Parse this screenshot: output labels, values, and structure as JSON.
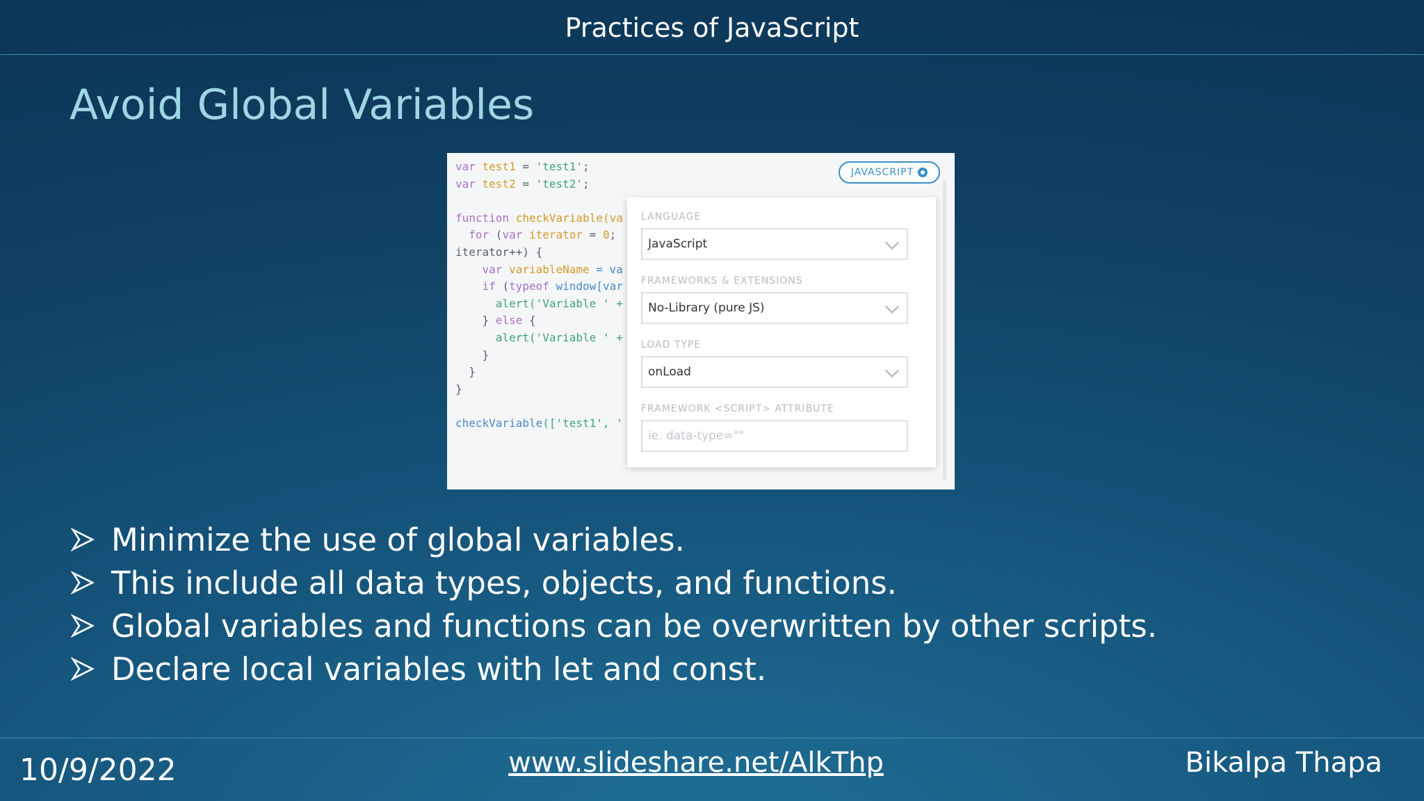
{
  "header": {
    "title": "Practices of JavaScript"
  },
  "slide": {
    "title": "Avoid Global Variables"
  },
  "screenshot": {
    "code_lines": [
      [
        {
          "t": "var ",
          "c": "c0"
        },
        {
          "t": "test1",
          "c": "c1"
        },
        {
          "t": " = ",
          "c": ""
        },
        {
          "t": "'test1'",
          "c": "c2"
        },
        {
          "t": ";",
          "c": ""
        }
      ],
      [
        {
          "t": "var ",
          "c": "c0"
        },
        {
          "t": "test2",
          "c": "c1"
        },
        {
          "t": " = ",
          "c": ""
        },
        {
          "t": "'test2'",
          "c": "c2"
        },
        {
          "t": ";",
          "c": ""
        }
      ],
      [],
      [
        {
          "t": "function ",
          "c": "c0"
        },
        {
          "t": "checkVariable",
          "c": "c1"
        },
        {
          "t": "(va",
          "c": "c1"
        }
      ],
      [
        {
          "t": "  for ",
          "c": "c0"
        },
        {
          "t": "(",
          "c": ""
        },
        {
          "t": "var ",
          "c": "c0"
        },
        {
          "t": "iterator",
          "c": "c1"
        },
        {
          "t": " = ",
          "c": ""
        },
        {
          "t": "0",
          "c": "c1"
        },
        {
          "t": ";",
          "c": ""
        }
      ],
      [
        {
          "t": "iterator++) {",
          "c": ""
        }
      ],
      [
        {
          "t": "    var ",
          "c": "c0"
        },
        {
          "t": "variableName",
          "c": "c1"
        },
        {
          "t": " = va",
          "c": "c3"
        }
      ],
      [
        {
          "t": "    if ",
          "c": "c0"
        },
        {
          "t": "(",
          "c": ""
        },
        {
          "t": "typeof ",
          "c": "c0"
        },
        {
          "t": "window[var",
          "c": "c3"
        }
      ],
      [
        {
          "t": "      alert(",
          "c": "c2"
        },
        {
          "t": "'Variable ' +",
          "c": "c2"
        }
      ],
      [
        {
          "t": "    } ",
          "c": ""
        },
        {
          "t": "else",
          "c": "c0"
        },
        {
          "t": " {",
          "c": ""
        }
      ],
      [
        {
          "t": "      alert(",
          "c": "c2"
        },
        {
          "t": "'Variable ' +",
          "c": "c2"
        }
      ],
      [
        {
          "t": "    }",
          "c": ""
        }
      ],
      [
        {
          "t": "  }",
          "c": ""
        }
      ],
      [
        {
          "t": "}",
          "c": ""
        }
      ],
      [],
      [
        {
          "t": "checkVariable",
          "c": "c3"
        },
        {
          "t": "(['test1', '",
          "c": "c2"
        }
      ]
    ],
    "badge": "JAVASCRIPT",
    "language_label": "LANGUAGE",
    "language_value": "JavaScript",
    "frameworks_label": "FRAMEWORKS & EXTENSIONS",
    "frameworks_value": "No-Library (pure JS)",
    "load_label": "LOAD TYPE",
    "load_value": "onLoad",
    "attr_label": "FRAMEWORK <SCRIPT> ATTRIBUTE",
    "attr_placeholder": "ie. data-type=\"\""
  },
  "bullets": [
    "Minimize the use of global variables.",
    "This include all data types, objects, and functions.",
    "Global variables and functions can be overwritten by other scripts.",
    "Declare local variables with let and const."
  ],
  "footer": {
    "date": "10/9/2022",
    "link": "www.slideshare.net/AlkThp",
    "author": "Bikalpa Thapa"
  }
}
